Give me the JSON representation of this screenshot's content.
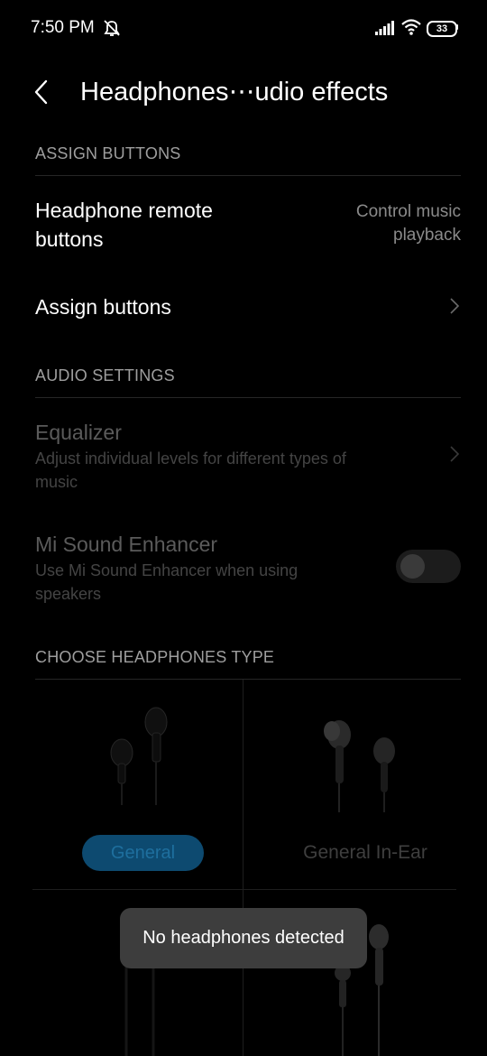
{
  "status_bar": {
    "time": "7:50 PM",
    "battery": "33"
  },
  "header": {
    "title": "Headphones⋯udio  effects"
  },
  "sections": {
    "assign_buttons": "ASSIGN BUTTONS",
    "audio_settings": "AUDIO SETTINGS",
    "choose_type": "CHOOSE HEADPHONES TYPE"
  },
  "rows": {
    "remote_title_line1": "Headphone remote",
    "remote_title_line2": "buttons",
    "remote_value_line1": "Control music",
    "remote_value_line2": "playback",
    "assign_title": "Assign buttons",
    "equalizer_title": "Equalizer",
    "equalizer_sub_line1": "Adjust individual levels for different types of",
    "equalizer_sub_line2": "music",
    "enhancer_title": "Mi Sound Enhancer",
    "enhancer_sub_line1": "Use Mi Sound Enhancer when using",
    "enhancer_sub_line2": "speakers",
    "enhancer_enabled": false
  },
  "headphone_types": {
    "general": "General",
    "general_in_ear": "General In-Ear"
  },
  "toast": "No headphones detected",
  "colors": {
    "background": "#000000",
    "accent_selected": "#0d4a70"
  }
}
